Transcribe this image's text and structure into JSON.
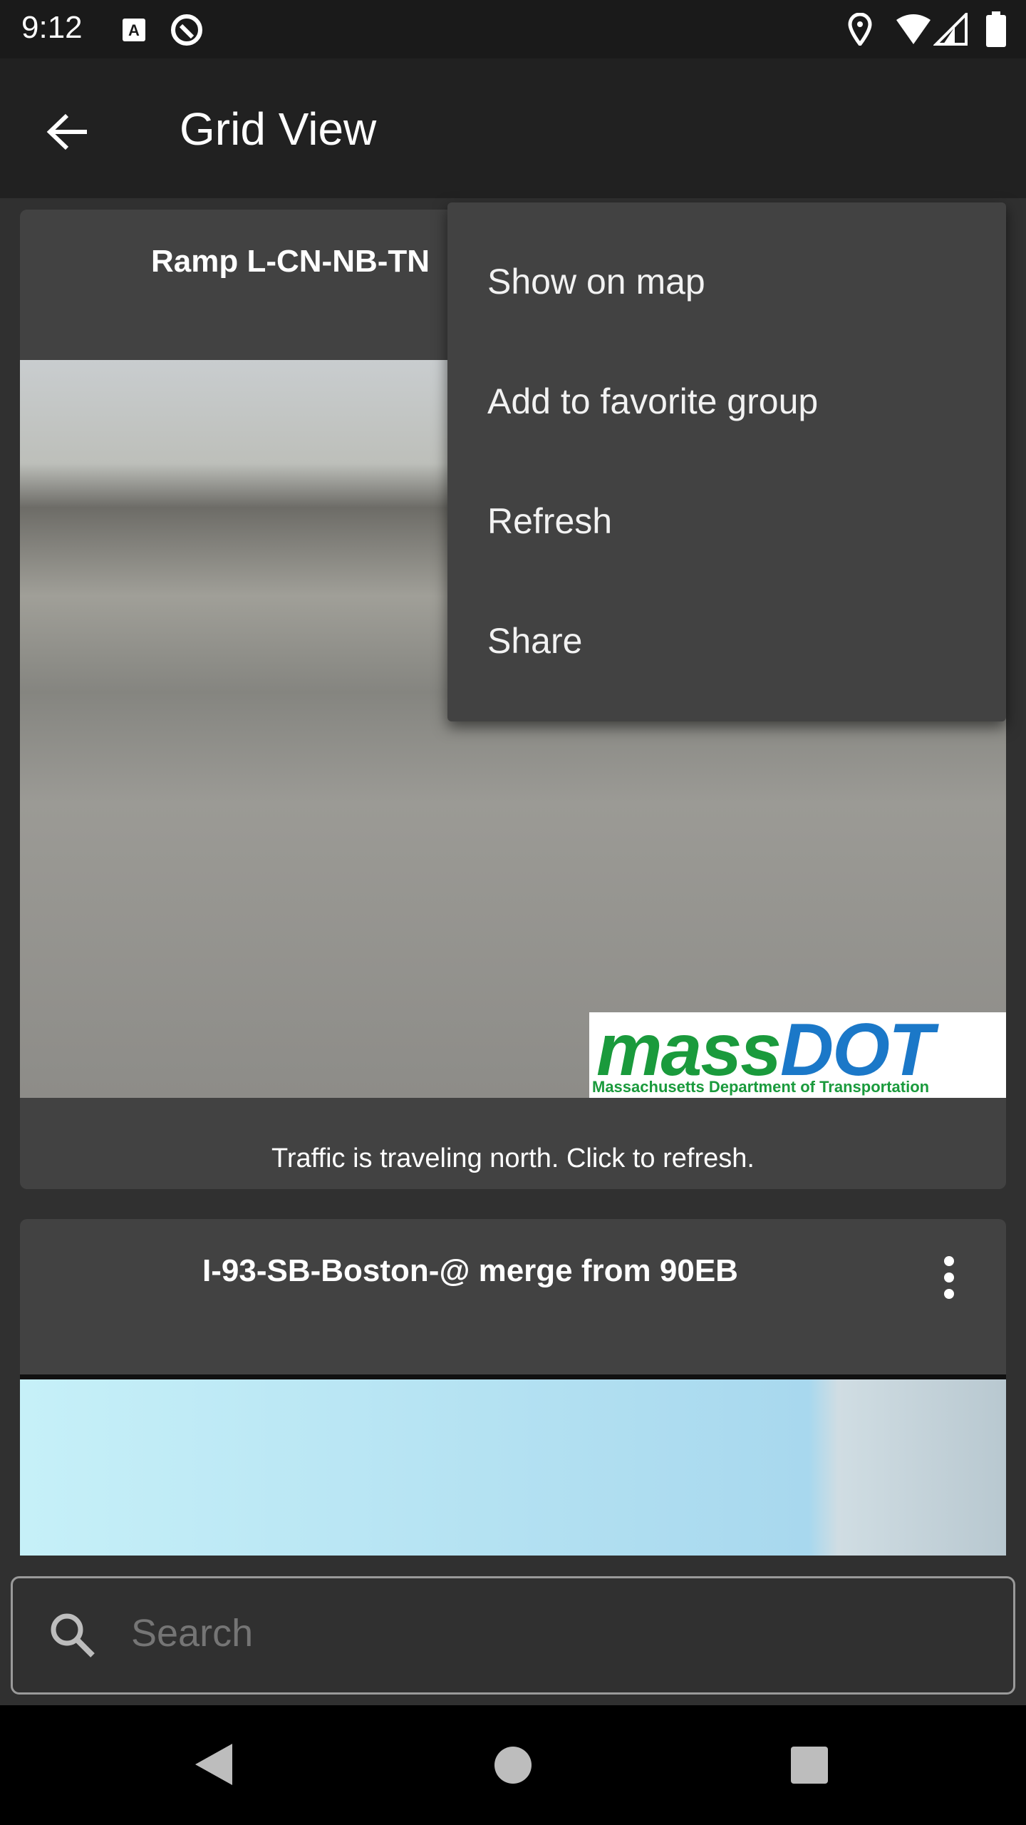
{
  "status_bar": {
    "time": "9:12",
    "icons": [
      "a-notification-icon",
      "sync-icon",
      "location-icon",
      "wifi-icon",
      "signal-icon",
      "battery-icon"
    ]
  },
  "app_bar": {
    "title": "Grid View",
    "back_icon": "arrow-back-icon"
  },
  "cameras": [
    {
      "title": "Ramp L-CN-NB-TN",
      "caption": "Traffic is traveling north. Click to refresh.",
      "logo": "massDOT",
      "logo_sub": "Massachusetts Department of Transportation"
    },
    {
      "title": "I-93-SB-Boston-@ merge from 90EB"
    }
  ],
  "menu": {
    "items": [
      "Show on map",
      "Add to favorite group",
      "Refresh",
      "Share"
    ]
  },
  "search": {
    "placeholder": "Search",
    "value": ""
  },
  "nav": {
    "icons": [
      "back-triangle-icon",
      "home-circle-icon",
      "recents-square-icon"
    ]
  }
}
